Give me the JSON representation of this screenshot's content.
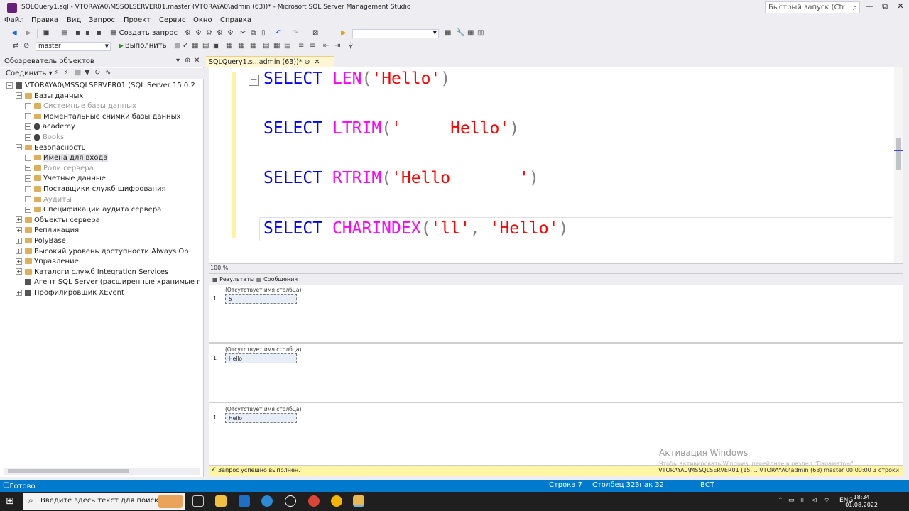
{
  "window": {
    "title": "SQLQuery1.sql - VTORAYA0\\MSSQLSERVER01.master (VTORAYA0\\admin (63))* - Microsoft SQL Server Management Studio",
    "quick_launch": "Быстрый запуск (Ctr",
    "minimize": "—",
    "restore": "⧉",
    "close": "✕"
  },
  "menu": [
    "Файл",
    "Правка",
    "Вид",
    "Запрос",
    "Проект",
    "Сервис",
    "Окно",
    "Справка"
  ],
  "toolbar": {
    "new_query": "Создать запрос",
    "database": "master",
    "execute": "Выполнить"
  },
  "object_explorer": {
    "title": "Обозреватель объектов",
    "connect": "Соединить ▾",
    "nodes": [
      {
        "label": "VTORAYA0\\MSSQLSERVER01 (SQL Server 15.0.2",
        "level": 0,
        "exp": "⊟",
        "icon": "server",
        "dim": false
      },
      {
        "label": "Базы данных",
        "level": 1,
        "exp": "⊟",
        "icon": "folder",
        "dim": false
      },
      {
        "label": "Системные базы данных",
        "level": 2,
        "exp": "⊞",
        "icon": "folder",
        "dim": true
      },
      {
        "label": "Моментальные снимки базы данных",
        "level": 2,
        "exp": "⊞",
        "icon": "folder",
        "dim": false
      },
      {
        "label": "academy",
        "level": 2,
        "exp": "⊞",
        "icon": "db",
        "dim": false
      },
      {
        "label": "Books",
        "level": 2,
        "exp": "⊞",
        "icon": "db",
        "dim": true
      },
      {
        "label": "Безопасность",
        "level": 1,
        "exp": "⊟",
        "icon": "folder",
        "dim": false
      },
      {
        "label": "Имена для входа",
        "level": 2,
        "exp": "⊞",
        "icon": "folder",
        "dim": false
      },
      {
        "label": "Роли сервера",
        "level": 2,
        "exp": "⊞",
        "icon": "folder",
        "dim": true
      },
      {
        "label": "Учетные данные",
        "level": 2,
        "exp": "⊞",
        "icon": "folder",
        "dim": false
      },
      {
        "label": "Поставщики служб шифрования",
        "level": 2,
        "exp": "⊞",
        "icon": "folder",
        "dim": false
      },
      {
        "label": "Аудиты",
        "level": 2,
        "exp": "⊞",
        "icon": "folder",
        "dim": true
      },
      {
        "label": "Спецификации аудита сервера",
        "level": 2,
        "exp": "⊞",
        "icon": "folder",
        "dim": false
      },
      {
        "label": "Объекты сервера",
        "level": 1,
        "exp": "⊞",
        "icon": "folder",
        "dim": false
      },
      {
        "label": "Репликация",
        "level": 1,
        "exp": "⊞",
        "icon": "folder",
        "dim": false
      },
      {
        "label": "PolyBase",
        "level": 1,
        "exp": "⊞",
        "icon": "folder",
        "dim": false
      },
      {
        "label": "Высокий уровень доступности Always On",
        "level": 1,
        "exp": "⊞",
        "icon": "folder",
        "dim": false
      },
      {
        "label": "Управление",
        "level": 1,
        "exp": "⊞",
        "icon": "folder",
        "dim": false
      },
      {
        "label": "Каталоги служб Integration Services",
        "level": 1,
        "exp": "⊞",
        "icon": "folder",
        "dim": false
      },
      {
        "label": "Агент SQL Server (расширенные хранимые г",
        "level": 1,
        "exp": "",
        "icon": "agent",
        "dim": false
      },
      {
        "label": "Профилировщик XEvent",
        "level": 1,
        "exp": "⊞",
        "icon": "agent",
        "dim": false
      }
    ]
  },
  "editor": {
    "tab_label": "SQLQuery1.s...admin (63))*",
    "pin": "⊕",
    "close": "✕",
    "lines": [
      {
        "kw": "SELECT ",
        "fn": "LEN",
        "open": "(",
        "arg1": "'Hello'",
        "sep": "",
        "arg2": "",
        "close": ")"
      },
      {
        "kw": "SELECT ",
        "fn": "LTRIM",
        "open": "(",
        "arg1": "'     Hello'",
        "sep": "",
        "arg2": "",
        "close": ")"
      },
      {
        "kw": "SELECT ",
        "fn": "RTRIM",
        "open": "(",
        "arg1": "'Hello       '",
        "sep": "",
        "arg2": "",
        "close": ")"
      },
      {
        "kw": "SELECT ",
        "fn": "CHARINDEX",
        "open": "(",
        "arg1": "'ll'",
        "sep": ", ",
        "arg2": "'Hello'",
        "close": ")"
      }
    ],
    "zoom": "100 %"
  },
  "results": {
    "tab_results": "Результаты",
    "tab_messages": "Сообщения",
    "grids": [
      {
        "header": "(Отсутствует имя столбца)",
        "row": "1",
        "value": "5"
      },
      {
        "header": "(Отсутствует имя столбца)",
        "row": "1",
        "value": "Hello"
      },
      {
        "header": "(Отсутствует имя столбца)",
        "row": "1",
        "value": "Hello"
      }
    ]
  },
  "query_status": {
    "message": "Запрос успешно выполнен.",
    "server": "VTORAYA0\\MSSQLSERVER01 (15.... VTORAYA0\\admin (63)   master   00:00:00   3 строки"
  },
  "watermark": {
    "title": "Активация Windows",
    "subtitle": "Чтобы активировать Windows, перейдите в раздел \"Параметры\"."
  },
  "statusbar": {
    "ready": "Готово",
    "row": "Строка 7",
    "col": "Столбец 32",
    "ch": "Знак 32",
    "ins": "ВСТ"
  },
  "taskbar": {
    "search_placeholder": "Введите здесь текст для поиска",
    "lang": "ENG",
    "time": "18:34",
    "date": "01.08.2022"
  }
}
